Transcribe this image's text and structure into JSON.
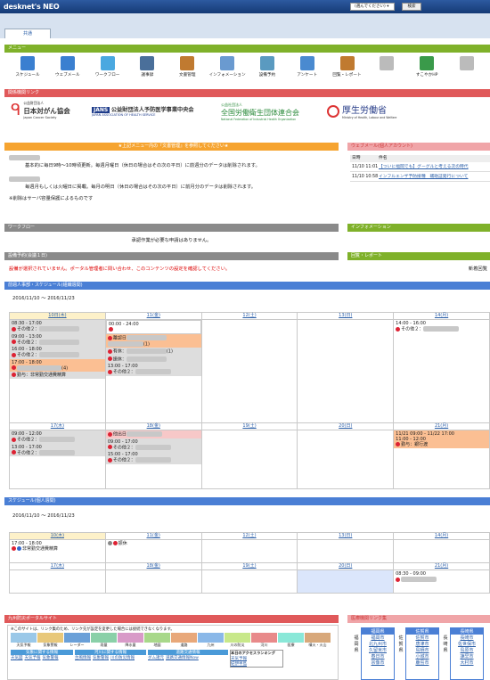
{
  "app": {
    "logo": "desknet's NEO",
    "search_select": "(選んでください)",
    "search_button": "検索"
  },
  "tabs": [
    {
      "label": "共通"
    }
  ],
  "menu": {
    "title": "メニュー",
    "items": [
      {
        "label": "スケジュール",
        "icon": "calendar-icon",
        "color": "#3a7fd0"
      },
      {
        "label": "ウェブメール",
        "icon": "mail-icon",
        "color": "#3a7fd0"
      },
      {
        "label": "ワークフロー",
        "icon": "workflow-icon",
        "color": "#4aa8e0"
      },
      {
        "label": "議事録",
        "icon": "minutes-icon",
        "color": "#4a6f9a"
      },
      {
        "label": "文書管理",
        "icon": "document-icon",
        "color": "#c07a30"
      },
      {
        "label": "インフォメーション",
        "icon": "information-icon",
        "color": "#6a9ad0"
      },
      {
        "label": "設備予約",
        "icon": "facility-icon",
        "color": "#5a9ac0"
      },
      {
        "label": "アンケート",
        "icon": "survey-icon",
        "color": "#4a8ad0"
      },
      {
        "label": "回覧・レポート",
        "icon": "report-icon",
        "color": "#c07a30"
      },
      {
        "label": "",
        "icon": "blurred-icon",
        "color": "#bbbbbb"
      },
      {
        "label": "すこやかHP",
        "icon": "leaf-icon",
        "color": "#3a9a4a"
      },
      {
        "label": "",
        "icon": "blurred-icon",
        "color": "#bbbbbb"
      }
    ]
  },
  "links": {
    "title": "関係機関リンク",
    "orgs": [
      {
        "small": "公益財団法人",
        "name": "日本対がん協会",
        "en": "Japan Cancer Society"
      },
      {
        "small": "JANS",
        "name": "公益財団法人予防医学事業中央会",
        "en": "JAPAN ASSOCIATION OF HEALTH SERVICE"
      },
      {
        "small": "公益社団法人",
        "name": "全国労働衛生団体連合会",
        "en": "National Federation of Industrial Health Organization"
      },
      {
        "small": "",
        "name": "厚生労働省",
        "en": "Ministry of Health, Labour and Welfare"
      }
    ]
  },
  "notice": {
    "title": "★上記メニュー内の『文書管理』を参照してください★",
    "line1": "基本的に毎日9時～10時頃更新。毎週月曜日（休日の場合はその次の平日）に前週分のデータは削除されます。",
    "line2": "毎週月もしくは火曜日に掲載。毎月の明日（休日の場合はその次の平日）に前月分のデータは削除されます。",
    "line3": "※削除はサーバ容量保護によるものです"
  },
  "webmail": {
    "title": "ウェブメール(個人アカウント)",
    "col_date": "日時",
    "col_subject": "件名",
    "rows": [
      {
        "date": "11/10 11:01",
        "subject": "【ついに福岡でも】グーグルと考える次の時代"
      },
      {
        "date": "11/10 10:58",
        "subject": "インフルエンザ予防接種　補助証発行について"
      }
    ]
  },
  "workflow": {
    "title": "ワークフロー",
    "text": "承認作業が必要な申請はありません。"
  },
  "info": {
    "title": "インフォメーション"
  },
  "facility": {
    "title": "設備予約(会議１日)",
    "text": "設備が選択されていません。ポータル管理者に問い合わせ、このコンテンツの設定を確認してください。"
  },
  "report": {
    "title": "回覧・レポート",
    "text": "新着回覧"
  },
  "group_sched": {
    "title": "前週人事部・スケジュール(組織週間)",
    "range": "2016/11/10 ～ 2016/11/23",
    "week1": [
      {
        "day": "10日(木)",
        "type": "today"
      },
      {
        "day": "11(金)",
        "type": "normal"
      },
      {
        "day": "12(土)",
        "type": "sat"
      },
      {
        "day": "13(日)",
        "type": "sun"
      },
      {
        "day": "14(月)",
        "type": "normal"
      }
    ],
    "week2": [
      {
        "day": "17(木)",
        "type": "normal"
      },
      {
        "day": "18(金)",
        "type": "normal"
      },
      {
        "day": "19(土)",
        "type": "sat"
      },
      {
        "day": "20(日)",
        "type": "sun"
      },
      {
        "day": "21(月)",
        "type": "normal"
      }
    ],
    "ev": {
      "a1": "08:30 - 17:00",
      "a2": "その他２：",
      "a3": "09:00 - 13:00",
      "a4": "その他２：",
      "a5": "16:00 - 18:00",
      "a6": "その他２：",
      "a7": "17:00 - 18:00",
      "a8": "(4)",
      "a9": "勤与：非常勤交通費精算",
      "b1": "00:00 - 24:00",
      "b2": "離認日",
      "b3": "(1)",
      "b4": "有休：",
      "b5": "(1)",
      "b6": "振休：",
      "b7": "13:00 - 17:00",
      "b8": "その他２：",
      "e1": "14:00 - 16:00",
      "e2": "その他２：",
      "f1": "09:00 - 12:00",
      "f2": "その他２：",
      "f3": "13:00 - 17:00",
      "f4": "その他２：",
      "g1": "他出日",
      "g2": "09:00 - 17:00",
      "g3": "その他２：",
      "g4": "15:00 - 17:00",
      "g5": "その他２：",
      "j1": "11/21 09:00 - 11/22 17:00",
      "j2": "11:00 - 12:00",
      "j3": "勤与：銀行渡"
    }
  },
  "personal_sched": {
    "title": "スケジュール(個人週間)",
    "range": "2016/11/10 ～ 2016/11/23",
    "week1": [
      {
        "day": "10(木)",
        "type": "today"
      },
      {
        "day": "11(金)",
        "type": "normal"
      },
      {
        "day": "12(土)",
        "type": "sat"
      },
      {
        "day": "13(日)",
        "type": "sun"
      },
      {
        "day": "14(月)",
        "type": "normal"
      }
    ],
    "week2": [
      {
        "day": "17(木)",
        "type": "normal"
      },
      {
        "day": "18(金)",
        "type": "normal"
      },
      {
        "day": "19(土)",
        "type": "sat"
      },
      {
        "day": "20(日)",
        "type": "sun"
      },
      {
        "day": "21(月)",
        "type": "normal"
      }
    ],
    "ev": {
      "a1": "17:00 - 18:00",
      "a2": "非常勤交通費精算",
      "b1": "振休",
      "j1": "08:30 - 09:00"
    }
  },
  "disaster": {
    "title": "九州防災ポータルサイト",
    "note": "※このサイトは、リンク集のため、リンク先が設定を変更した場合には接続できなくなります。",
    "tiles": [
      "天気予報",
      "気象警報",
      "レーダー",
      "雨量",
      "降水量",
      "地図",
      "道路",
      "九州",
      "川の防災",
      "河川",
      "医療",
      "噴火・火山"
    ],
    "h1": "気象に関する情報",
    "h2": "河川に関する情報",
    "h3": "道路交通情報",
    "h4": "本日のアクセスランキング",
    "l1": [
      "天気図",
      "天気予報",
      "気象警報"
    ],
    "l2": [
      "台風情報",
      "気象警報",
      "川の防災情報"
    ],
    "l3": [
      "ダム諸元",
      "道路交通情報Now"
    ],
    "l4": [
      "天気予報",
      "紀伊半島"
    ]
  },
  "hospitals": {
    "title": "医療機関リンク集",
    "cols": [
      {
        "pref": "福岡県",
        "cities": [
          "福岡市",
          "北九州市",
          "久留米市",
          "春日市",
          "宗像市"
        ]
      },
      {
        "pref": "佐賀県",
        "cities": [
          "佐賀市",
          "唐津市",
          "鳥栖市",
          "小城市",
          "鹿島市"
        ]
      },
      {
        "pref": "長崎県",
        "cities": [
          "長崎市",
          "佐世保市",
          "島原市",
          "諫早市",
          "大村市"
        ]
      }
    ],
    "sides": [
      "福",
      "岡",
      "県"
    ],
    "sides2": [
      "佐",
      "賀",
      "県"
    ],
    "sides3": [
      "長",
      "崎",
      "県"
    ]
  }
}
